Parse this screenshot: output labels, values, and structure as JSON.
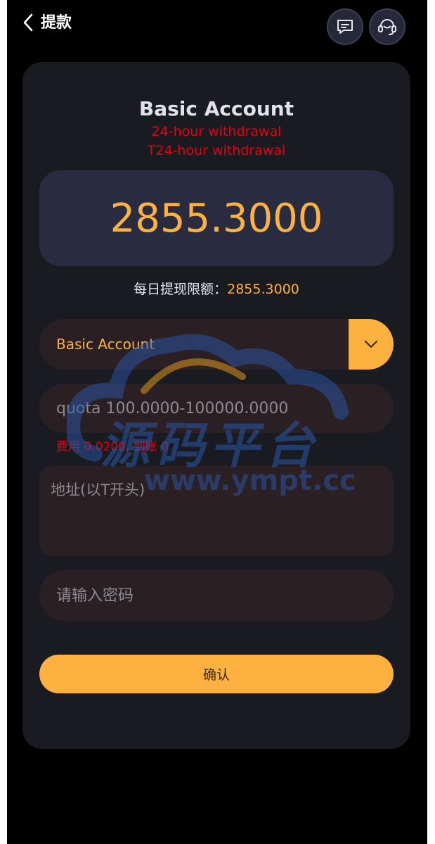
{
  "header": {
    "title": "提款",
    "back_icon": "chevron-left-icon",
    "message_icon": "message-icon",
    "support_icon": "headset-icon"
  },
  "card": {
    "account_name": "Basic Account",
    "notes": [
      "24-hour withdrawal",
      "T24-hour withdrawal"
    ],
    "balance": "2855.3000",
    "daily_limit_label": "每日提现限额：",
    "daily_limit_value": "2855.3000"
  },
  "form": {
    "account_select": {
      "selected": "Basic Account",
      "icon": "chevron-down-icon"
    },
    "amount_placeholder": "quota 100.0000-100000.0000",
    "fee_text": "费用 0.0200, 到账 0",
    "address_placeholder": "地址(以T开头)",
    "password_placeholder": "请输入密码",
    "confirm_label": "确认"
  },
  "watermark": {
    "logo_text": "源码平台",
    "url": "www.ympt.cc"
  },
  "colors": {
    "accent": "#fdb13e",
    "warning": "#e60012",
    "card_bg": "#1a1b21",
    "input_bg": "#2a2024",
    "balance_bg": "#292c40"
  }
}
